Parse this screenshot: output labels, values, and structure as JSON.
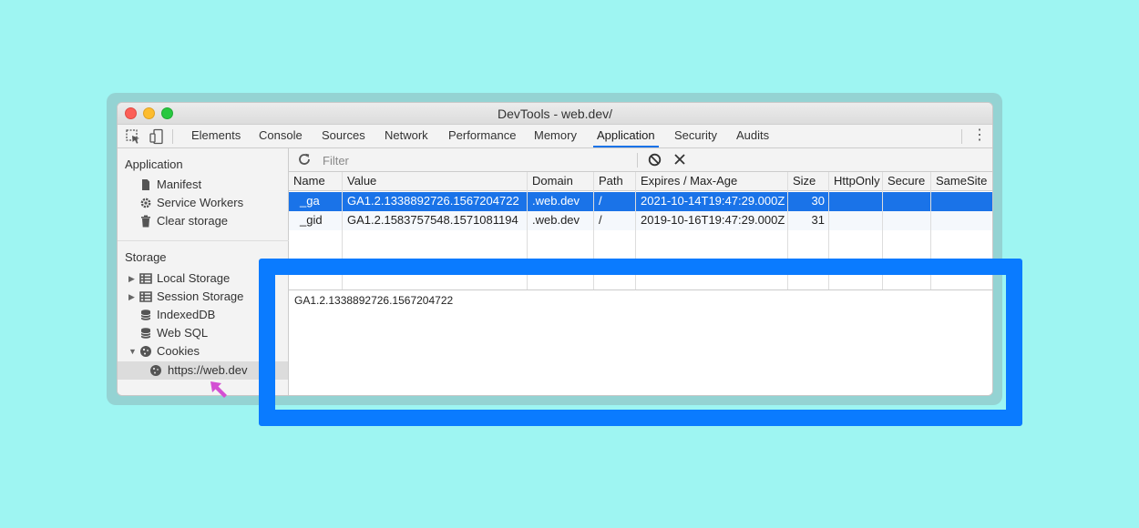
{
  "window": {
    "title": "DevTools - web.dev/"
  },
  "tabs": [
    "Elements",
    "Console",
    "Sources",
    "Network",
    "Performance",
    "Memory",
    "Application",
    "Security",
    "Audits"
  ],
  "active_tab": "Application",
  "sidebar": {
    "application_heading": "Application",
    "application_items": [
      "Manifest",
      "Service Workers",
      "Clear storage"
    ],
    "storage_heading": "Storage",
    "storage_items": [
      "Local Storage",
      "Session Storage",
      "IndexedDB",
      "Web SQL",
      "Cookies"
    ],
    "cookie_origin": "https://web.dev"
  },
  "filter": {
    "placeholder": "Filter",
    "value": ""
  },
  "table": {
    "columns": [
      "Name",
      "Value",
      "Domain",
      "Path",
      "Expires / Max-Age",
      "Size",
      "HttpOnly",
      "Secure",
      "SameSite"
    ],
    "rows": [
      {
        "Name": "_ga",
        "Value": "GA1.2.1338892726.1567204722",
        "Domain": ".web.dev",
        "Path": "/",
        "Expires / Max-Age": "2021-10-14T19:47:29.000Z",
        "Size": "30",
        "HttpOnly": "",
        "Secure": "",
        "SameSite": ""
      },
      {
        "Name": "_gid",
        "Value": "GA1.2.1583757548.1571081194",
        "Domain": ".web.dev",
        "Path": "/",
        "Expires / Max-Age": "2019-10-16T19:47:29.000Z",
        "Size": "31",
        "HttpOnly": "",
        "Secure": "",
        "SameSite": ""
      }
    ],
    "selected_row": 0
  },
  "preview": {
    "value": "GA1.2.1338892726.1567204722"
  },
  "colors": {
    "background": "#9ef5f2",
    "highlight": "#0a7bff",
    "selection": "#1a73e8",
    "pointer": "#d34fd3"
  }
}
